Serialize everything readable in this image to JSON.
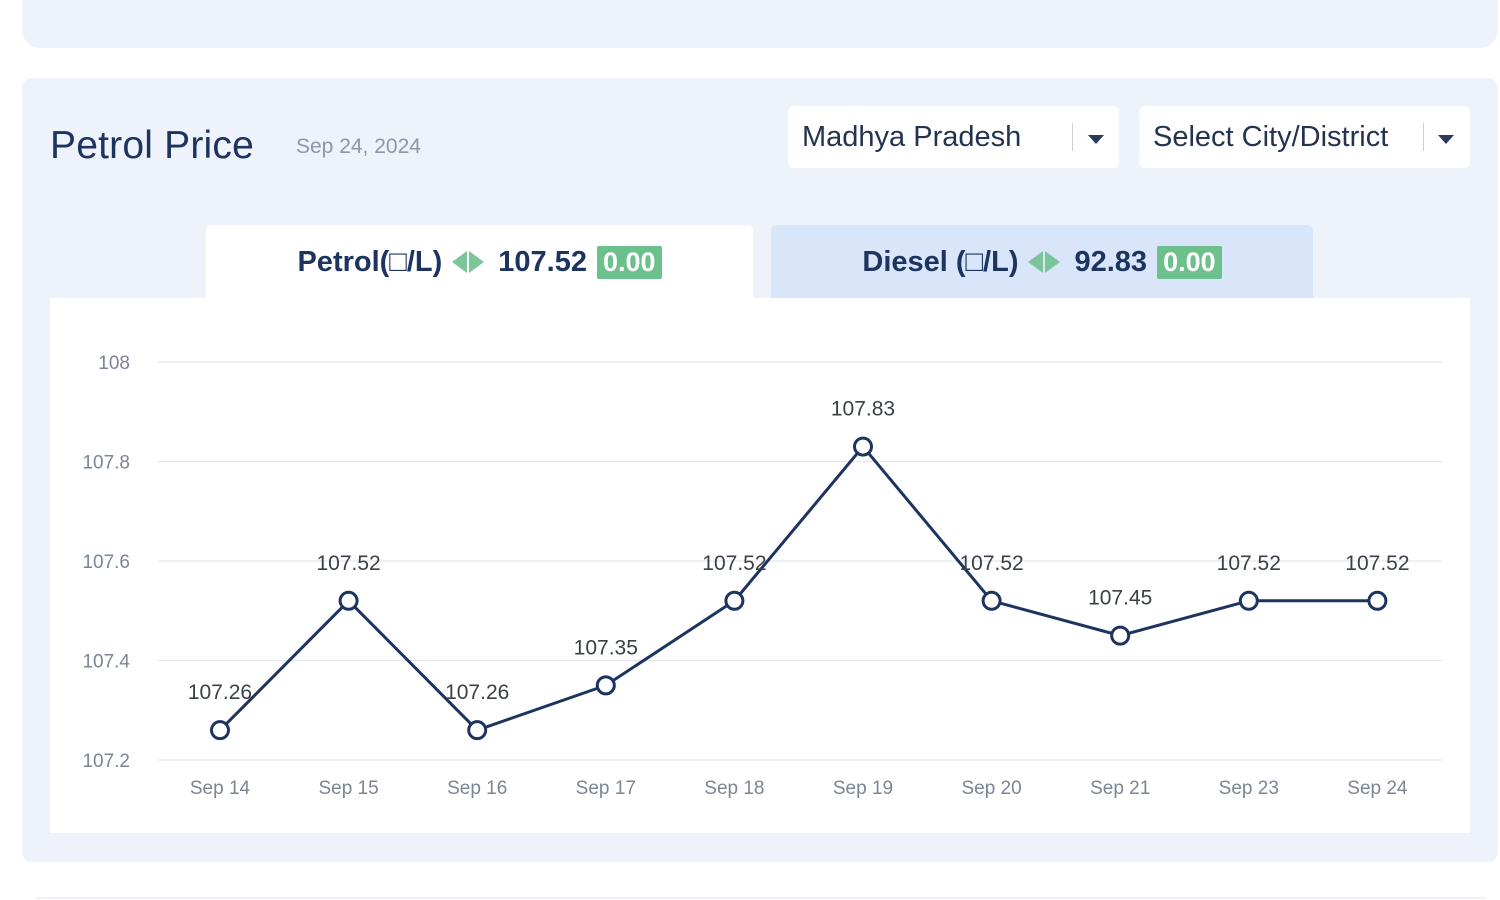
{
  "header": {
    "title": "Petrol Price",
    "date": "Sep 24, 2024"
  },
  "filters": {
    "state": "Madhya Pradesh",
    "city": "Select City/District"
  },
  "tabs": {
    "petrol": {
      "label": "Petrol(□/L)",
      "price": "107.52",
      "change": "0.00",
      "active": true
    },
    "diesel": {
      "label": "Diesel (□/L)",
      "price": "92.83",
      "change": "0.00",
      "active": false
    }
  },
  "icons": {
    "change": "left-right-arrows-icon",
    "dropdown": "caret-down-icon"
  },
  "colors": {
    "primary": "#1d3461",
    "line": "#1d3461",
    "badge": "#6cc08c",
    "card_bg": "#edf2fb",
    "active_tab": "#ffffff",
    "inactive_tab": "#d9e5f8"
  },
  "chart_data": {
    "type": "line",
    "categories": [
      "Sep 14",
      "Sep 15",
      "Sep 16",
      "Sep 17",
      "Sep 18",
      "Sep 19",
      "Sep 20",
      "Sep 21",
      "Sep 23",
      "Sep 24"
    ],
    "values": [
      107.26,
      107.52,
      107.26,
      107.35,
      107.52,
      107.83,
      107.52,
      107.45,
      107.52,
      107.52
    ],
    "data_labels": [
      "107.26",
      "107.52",
      "107.26",
      "107.35",
      "107.52",
      "107.83",
      "107.52",
      "107.45",
      "107.52",
      "107.52"
    ],
    "y_ticks": [
      "107.2",
      "107.4",
      "107.6",
      "107.8",
      "108"
    ],
    "ylim": [
      107.2,
      108
    ],
    "grid": "horizontal",
    "legend": "none",
    "title": "",
    "xlabel": "",
    "ylabel": ""
  }
}
